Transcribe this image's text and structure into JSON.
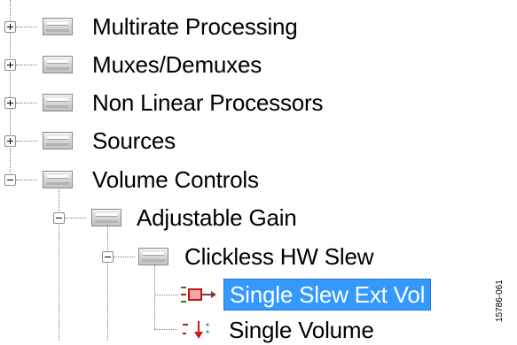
{
  "tree": {
    "items": [
      {
        "label": "Multirate Processing",
        "expanded": false
      },
      {
        "label": "Muxes/Demuxes",
        "expanded": false
      },
      {
        "label": "Non Linear Processors",
        "expanded": false
      },
      {
        "label": "Sources",
        "expanded": false
      },
      {
        "label": "Volume Controls",
        "expanded": true,
        "children": [
          {
            "label": "Adjustable Gain",
            "expanded": true,
            "children": [
              {
                "label": "Clickless HW Slew",
                "expanded": true,
                "children": [
                  {
                    "label": "Single Slew Ext Vol",
                    "selected": true,
                    "icon": "slew-module-icon"
                  },
                  {
                    "label": "Single Volume",
                    "icon": "volume-module-icon"
                  }
                ]
              }
            ]
          }
        ]
      }
    ],
    "selection_color": "#3399ff"
  },
  "figure_id": "15786-061"
}
